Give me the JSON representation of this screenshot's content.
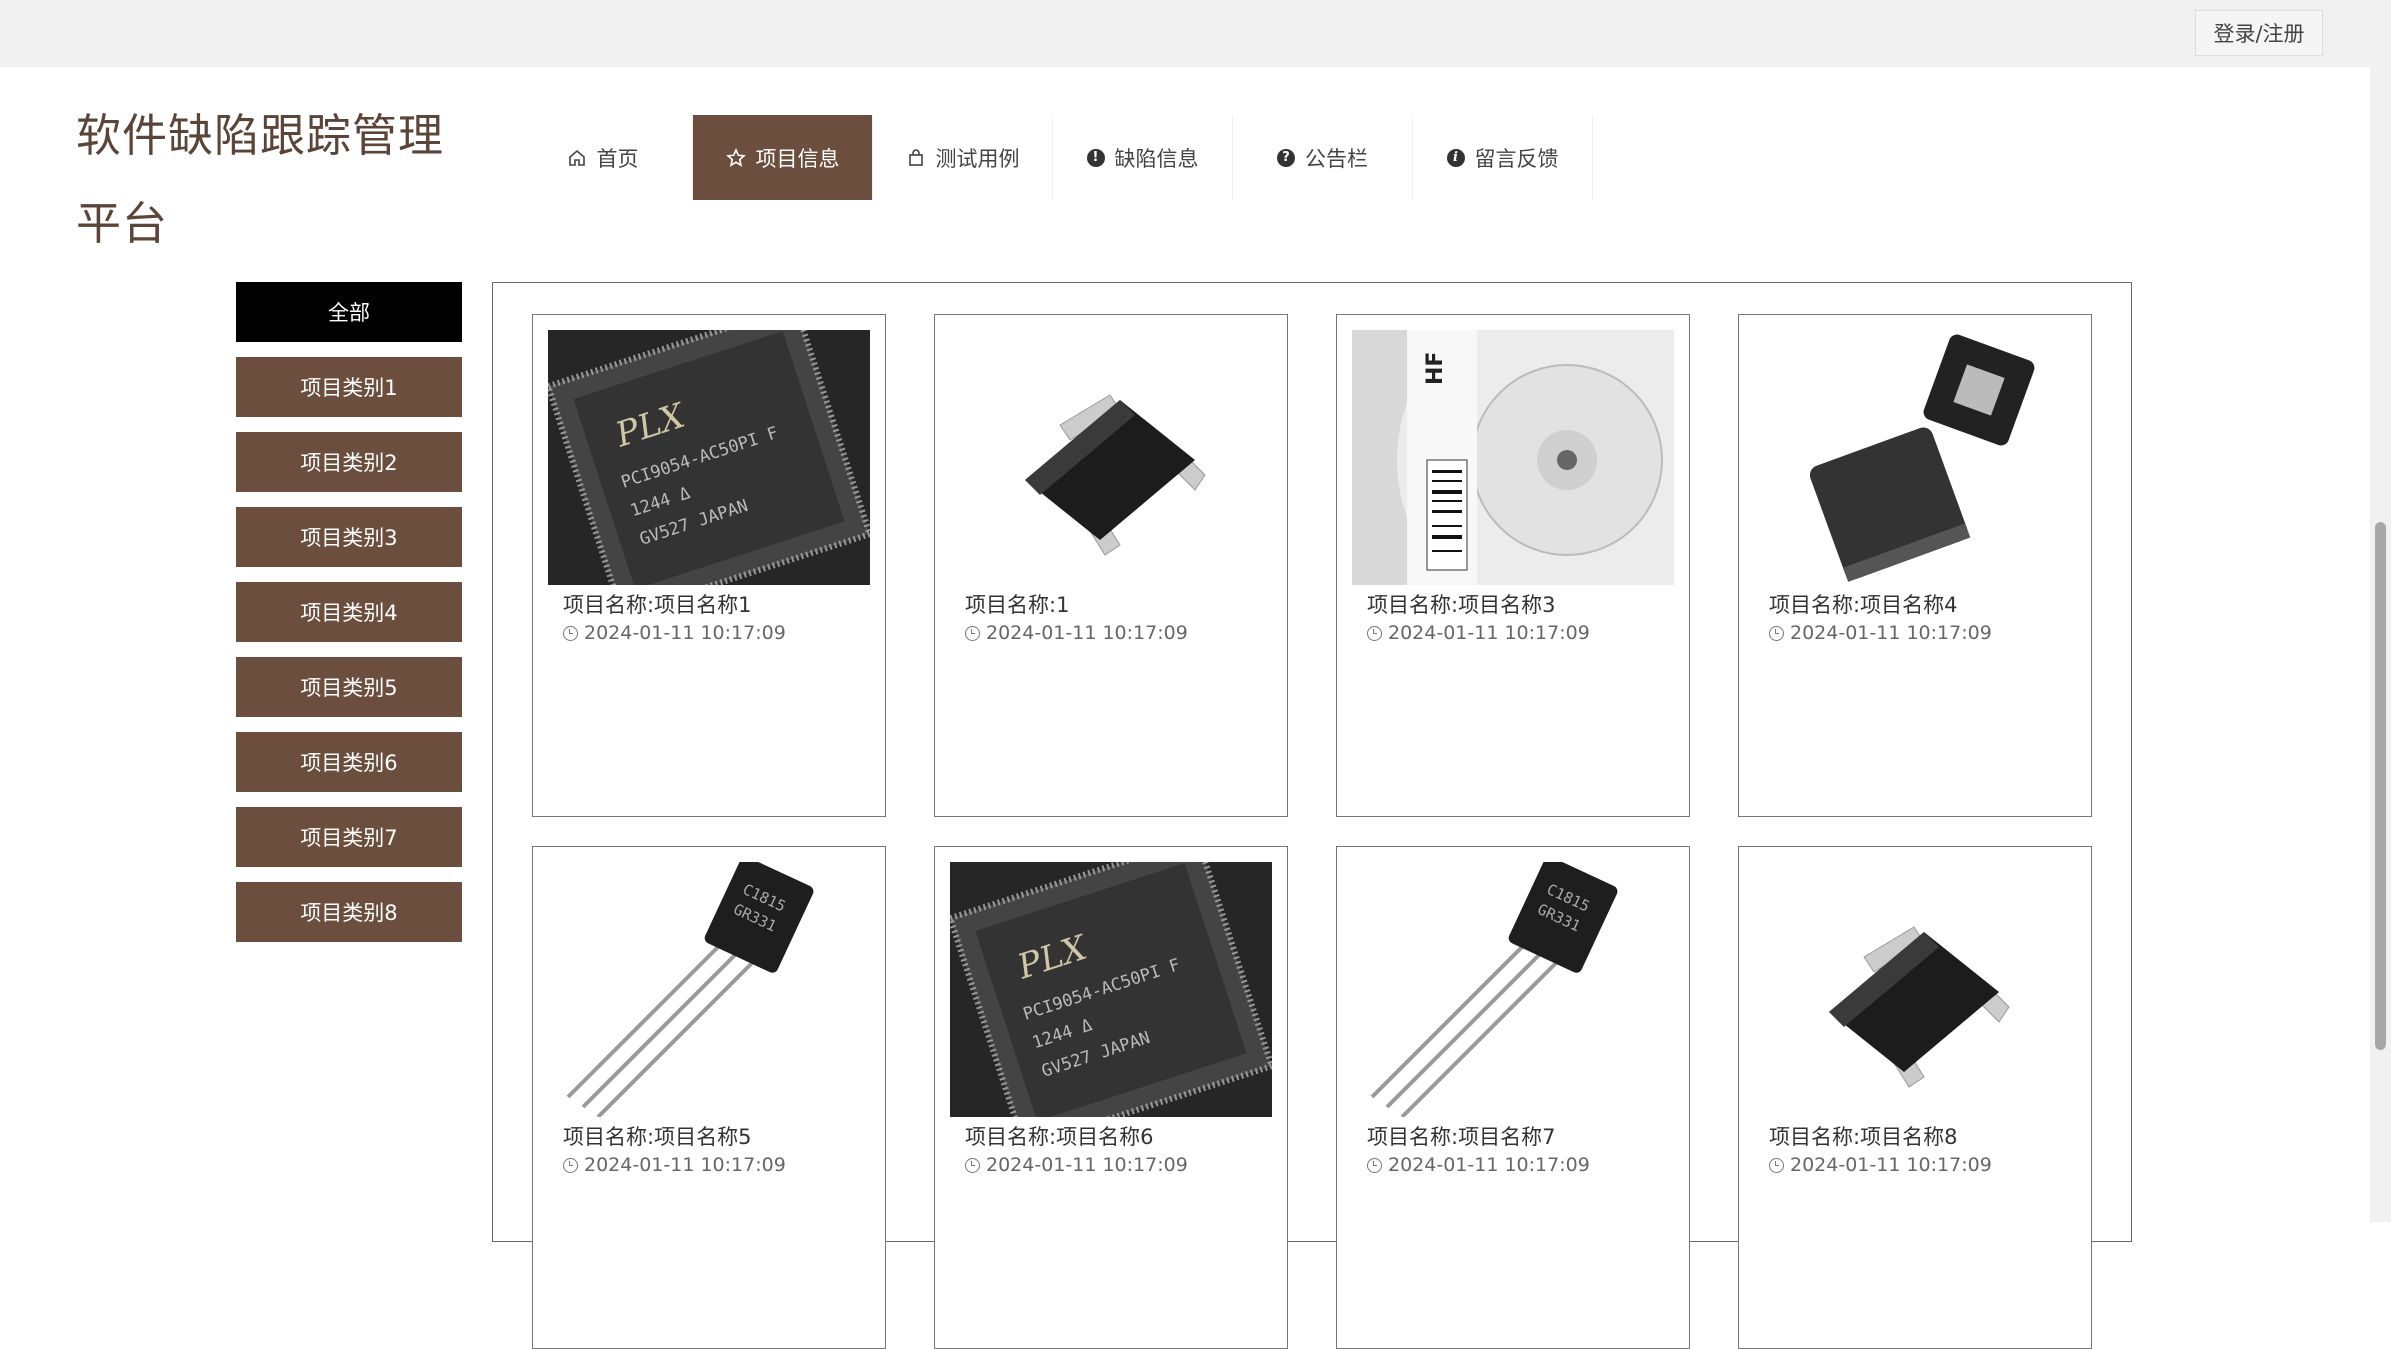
{
  "header": {
    "login_label": "登录/注册",
    "site_title": "软件缺陷跟踪管理平台"
  },
  "nav": {
    "items": [
      {
        "label": "首页",
        "icon": "home-icon"
      },
      {
        "label": "项目信息",
        "icon": "star-icon",
        "active": true
      },
      {
        "label": "测试用例",
        "icon": "shopping-bag-icon"
      },
      {
        "label": "缺陷信息",
        "icon": "exclamation-circle-icon"
      },
      {
        "label": "公告栏",
        "icon": "question-circle-icon"
      },
      {
        "label": "留言反馈",
        "icon": "info-circle-icon"
      }
    ]
  },
  "sidebar": {
    "categories": [
      {
        "label": "全部",
        "active": true
      },
      {
        "label": "项目类别1"
      },
      {
        "label": "项目类别2"
      },
      {
        "label": "项目类别3"
      },
      {
        "label": "项目类别4"
      },
      {
        "label": "项目类别5"
      },
      {
        "label": "项目类别6"
      },
      {
        "label": "项目类别7"
      },
      {
        "label": "项目类别8"
      }
    ]
  },
  "projects": [
    {
      "name": "项目名称:项目名称1",
      "time": "2024-01-11 10:17:09",
      "image": "qfp-chip-image"
    },
    {
      "name": "项目名称:1",
      "time": "2024-01-11 10:17:09",
      "image": "sot23-transistor-image"
    },
    {
      "name": "项目名称:项目名称3",
      "time": "2024-01-11 10:17:09",
      "image": "component-reel-image"
    },
    {
      "name": "项目名称:项目名称4",
      "time": "2024-01-11 10:17:09",
      "image": "qfn-chip-image"
    },
    {
      "name": "项目名称:项目名称5",
      "time": "2024-01-11 10:17:09",
      "image": "to92-transistor-image"
    },
    {
      "name": "项目名称:项目名称6",
      "time": "2024-01-11 10:17:09",
      "image": "qfp-chip-image"
    },
    {
      "name": "项目名称:项目名称7",
      "time": "2024-01-11 10:17:09",
      "image": "to92-transistor-image"
    },
    {
      "name": "项目名称:项目名称8",
      "time": "2024-01-11 10:17:09",
      "image": "sot23-transistor-image"
    }
  ],
  "colors": {
    "brand": "#6b4e3d",
    "active_category": "#000000",
    "topbar": "#f0f0f0"
  }
}
